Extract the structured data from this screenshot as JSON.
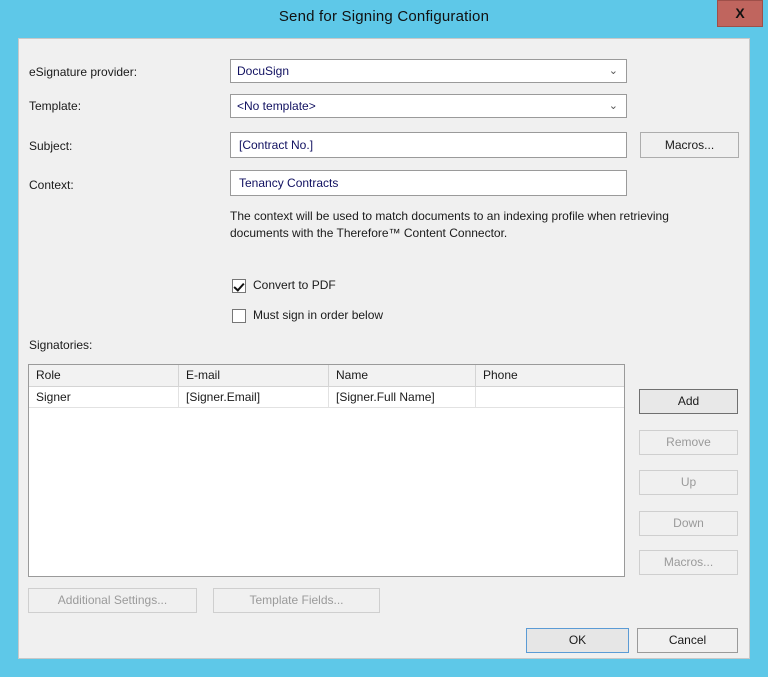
{
  "window": {
    "title": "Send for Signing Configuration",
    "close_label": "X"
  },
  "form": {
    "provider_label": "eSignature provider:",
    "provider_value": "DocuSign",
    "template_label": "Template:",
    "template_value": "<No template>",
    "subject_label": "Subject:",
    "subject_value": "[Contract No.]",
    "context_label": "Context:",
    "context_value": "Tenancy Contracts",
    "macros_button": "Macros...",
    "help_text": "The context will be used to match documents to an indexing profile when retrieving documents with the Therefore™ Content Connector.",
    "convert_to_pdf_label": "Convert to PDF",
    "convert_to_pdf_checked": true,
    "must_sign_order_label": "Must sign in order below",
    "must_sign_order_checked": false
  },
  "signatories": {
    "section_label": "Signatories:",
    "columns": [
      "Role",
      "E-mail",
      "Name",
      "Phone"
    ],
    "rows": [
      {
        "role": "Signer",
        "email": "[Signer.Email]",
        "name": "[Signer.Full Name]",
        "phone": ""
      }
    ],
    "buttons": {
      "add": "Add",
      "remove": "Remove",
      "up": "Up",
      "down": "Down",
      "macros": "Macros..."
    }
  },
  "footer": {
    "additional_settings": "Additional Settings...",
    "template_fields": "Template Fields...",
    "ok": "OK",
    "cancel": "Cancel"
  },
  "icons": {
    "chevron_down": "⌄"
  },
  "colors": {
    "window_frame": "#5ec8e8",
    "panel": "#f0f0f0",
    "close_button": "#c0655e",
    "field_text": "#101060",
    "focus_border": "#5b9bd5"
  }
}
